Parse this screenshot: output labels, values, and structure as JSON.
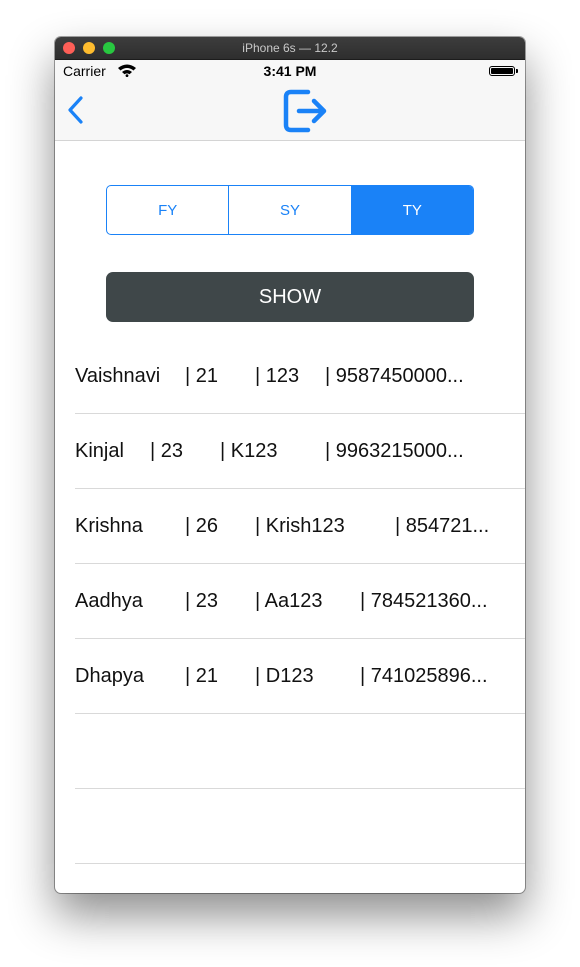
{
  "window": {
    "title": "iPhone 6s — 12.2"
  },
  "status_bar": {
    "carrier": "Carrier",
    "time": "3:41 PM"
  },
  "nav_bar": {
    "back_icon": "chevron-left-icon",
    "action_icon": "logout-icon"
  },
  "colors": {
    "accent": "#1a82f7",
    "button_dark": "#3f4749"
  },
  "segmented_control": {
    "options": [
      "FY",
      "SY",
      "TY"
    ],
    "selected": "TY"
  },
  "show_button": {
    "label": "SHOW"
  },
  "rows": [
    {
      "name": "Vaishnavi",
      "age": "| 21",
      "id": "| 123",
      "phone": "| 9587450000..."
    },
    {
      "name": "Kinjal",
      "age": "| 23",
      "id": "| K123",
      "phone": "| 9963215000..."
    },
    {
      "name": "Krishna",
      "age": "| 26",
      "id": "| Krish123",
      "phone": "| 854721..."
    },
    {
      "name": "Aadhya",
      "age": "| 23",
      "id": "| Aa123",
      "phone": "| 784521360..."
    },
    {
      "name": "Dhapya",
      "age": "| 21",
      "id": "| D123",
      "phone": "| 741025896..."
    },
    {
      "name": "",
      "age": "",
      "id": "",
      "phone": ""
    },
    {
      "name": "",
      "age": "",
      "id": "",
      "phone": ""
    }
  ]
}
